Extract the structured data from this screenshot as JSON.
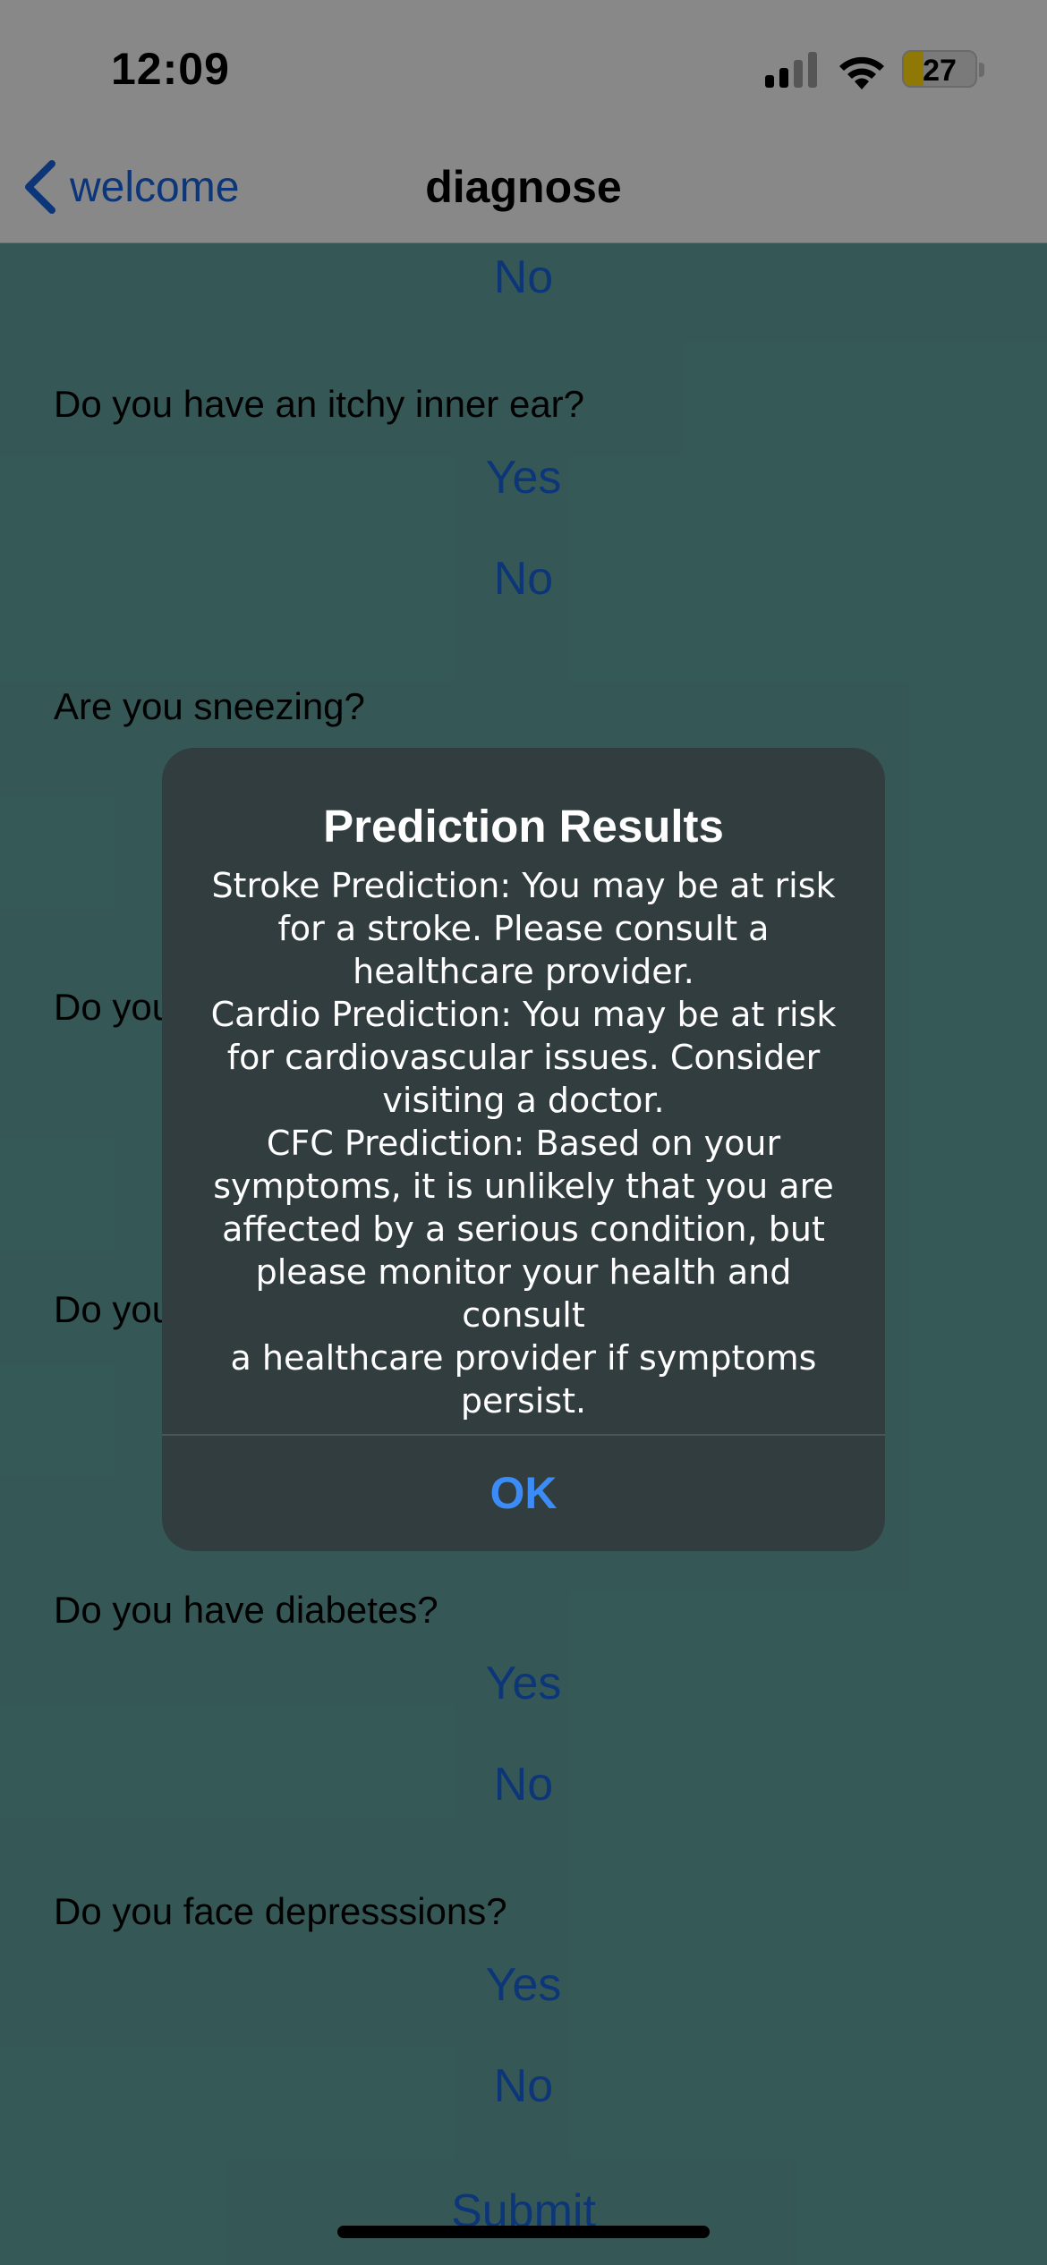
{
  "status_bar": {
    "time": "12:09",
    "battery_level": "27",
    "battery_color": "#ffd60a"
  },
  "nav": {
    "back_label": "welcome",
    "title": "diagnose"
  },
  "content": {
    "top_no": "No",
    "q_itchy": "Do you have an itchy inner ear?",
    "q_itchy_yes": "Yes",
    "q_itchy_no": "No",
    "q_sneezing": "Are you sneezing?",
    "q_hidden1": "Do you",
    "q_hidden2": "Do you",
    "q_diabetes": "Do you have diabetes?",
    "q_diabetes_yes": "Yes",
    "q_diabetes_no": "No",
    "q_depression": "Do you face depresssions?",
    "q_depression_yes": "Yes",
    "q_depression_no": "No",
    "submit_label": "Submit"
  },
  "alert": {
    "title": "Prediction Results",
    "message": "Stroke Prediction: You may be at risk\nfor a stroke. Please consult a\nhealthcare provider.\nCardio Prediction: You may be at risk\nfor cardiovascular issues. Consider\nvisiting a doctor.\nCFC Prediction: Based on your\nsymptoms, it is unlikely that you are\naffected by a serious condition, but\nplease monitor your health and consult\na healthcare provider if symptoms\npersist.",
    "ok_label": "OK"
  },
  "colors": {
    "accent": "#1860d8",
    "page_background": "#5f9e9b",
    "alert_background": "#313d3f",
    "ok_color": "#3b8cf6"
  },
  "icons": {
    "back": "chevron-left-icon",
    "signal": "cellular-signal-icon",
    "wifi": "wifi-icon",
    "battery": "battery-icon"
  }
}
